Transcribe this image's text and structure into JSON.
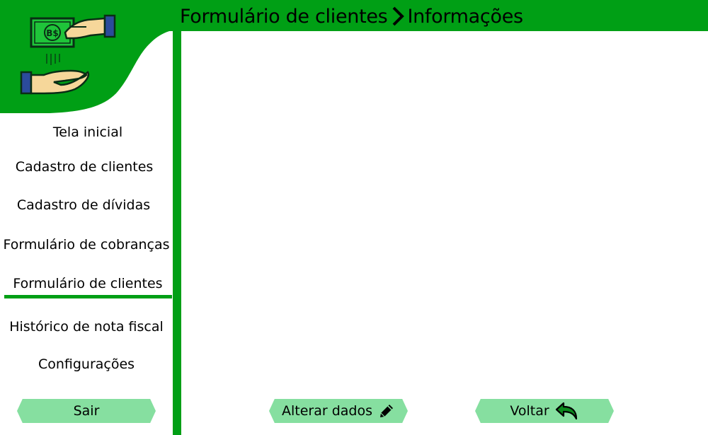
{
  "header": {
    "section": "Formulário de clientes",
    "page": "Informações"
  },
  "sidebar": {
    "items": [
      {
        "label": "Tela inicial"
      },
      {
        "label": "Cadastro de clientes"
      },
      {
        "label": "Cadastro de dívidas"
      },
      {
        "label": "Formulário de cobranças"
      },
      {
        "label": "Formulário de clientes",
        "active": true
      },
      {
        "label": "Histórico de nota fiscal"
      },
      {
        "label": "Configurações"
      }
    ],
    "exit_label": "Sair"
  },
  "logo": {
    "bill_text": "B$",
    "icon": "money-handover-icon"
  },
  "actions": {
    "edit_label": "Alterar dados",
    "edit_icon": "pencil-icon",
    "back_label": "Voltar",
    "back_icon": "undo-arrow-icon"
  },
  "colors": {
    "brand_green": "#009f15",
    "button_green": "#86dfa0"
  }
}
